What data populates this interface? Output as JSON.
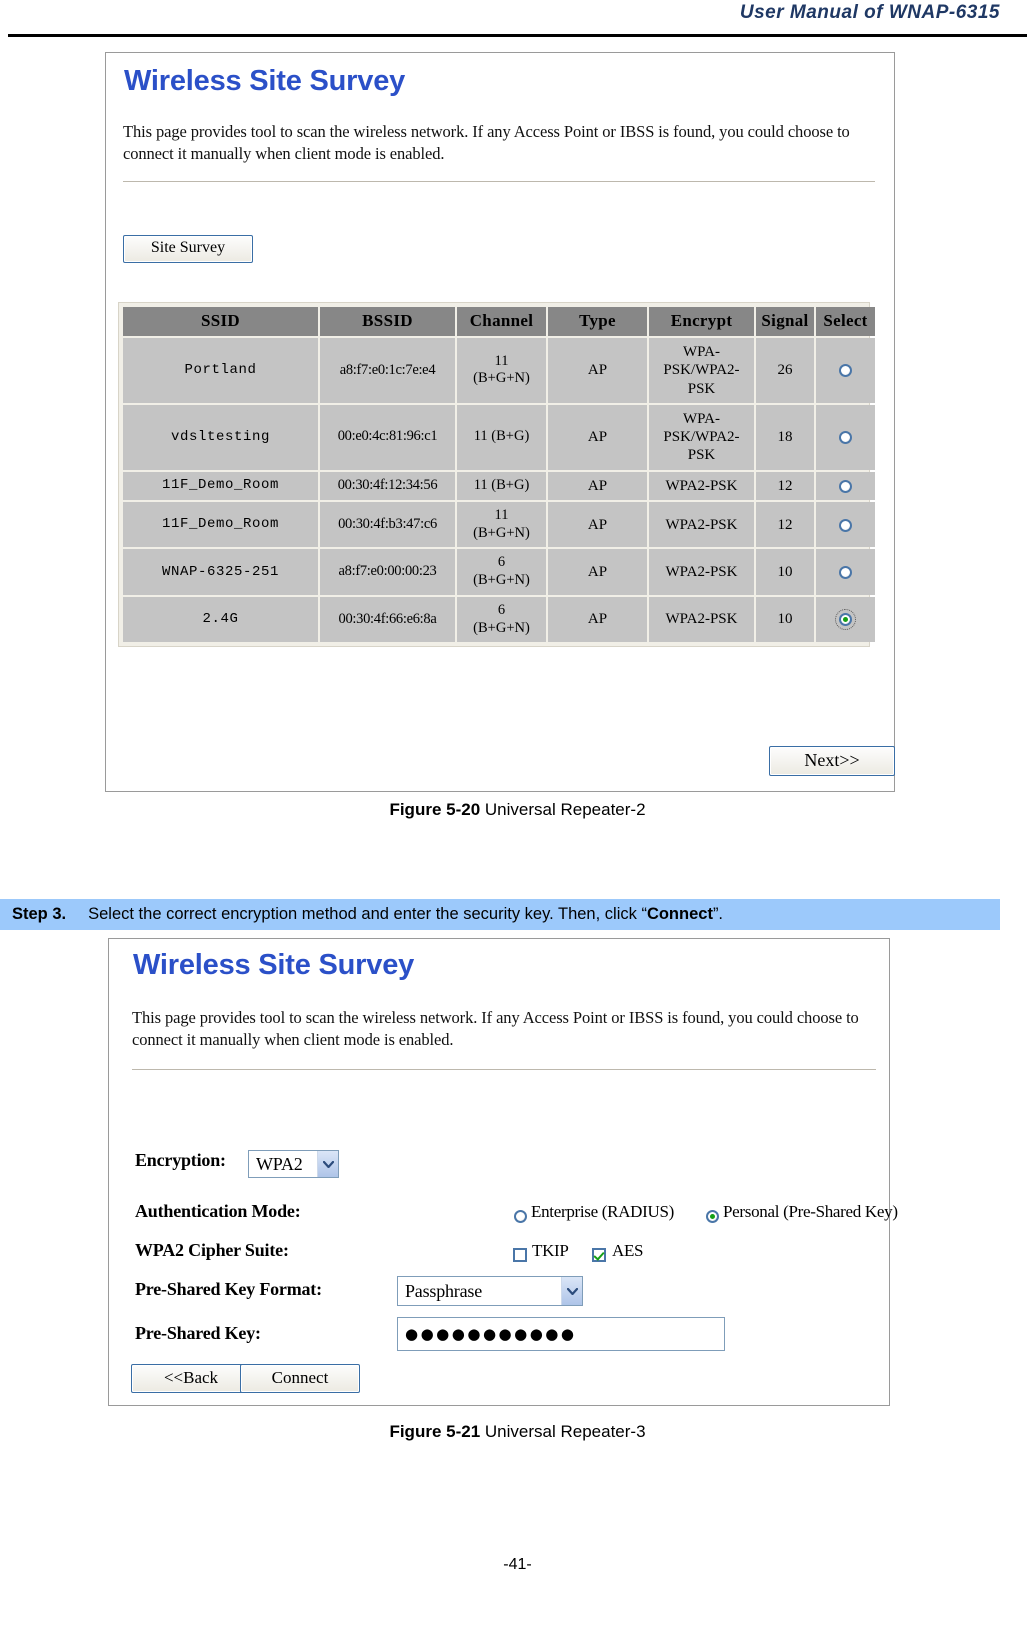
{
  "header": {
    "manual_title": "User  Manual  of  WNAP-6315"
  },
  "figure1": {
    "panel": {
      "title": "Wireless Site Survey",
      "description": "This page provides tool to scan the wireless network. If any Access Point or IBSS is found, you could choose to connect it manually when client mode is enabled.",
      "site_survey_button": "Site Survey",
      "next_button": "Next>>"
    },
    "table": {
      "columns": [
        "SSID",
        "BSSID",
        "Channel",
        "Type",
        "Encrypt",
        "Signal",
        "Select"
      ],
      "rows": [
        {
          "ssid": "Portland",
          "bssid": "a8:f7:e0:1c:7e:e4",
          "channel": "11 (B+G+N)",
          "type": "AP",
          "encrypt": "WPA-PSK/WPA2-PSK",
          "signal": "26",
          "selected": false
        },
        {
          "ssid": "vdsltesting",
          "bssid": "00:e0:4c:81:96:c1",
          "channel": "11 (B+G)",
          "type": "AP",
          "encrypt": "WPA-PSK/WPA2-PSK",
          "signal": "18",
          "selected": false
        },
        {
          "ssid": "11F_Demo_Room",
          "bssid": "00:30:4f:12:34:56",
          "channel": "11 (B+G)",
          "type": "AP",
          "encrypt": "WPA2-PSK",
          "signal": "12",
          "selected": false
        },
        {
          "ssid": "11F_Demo_Room",
          "bssid": "00:30:4f:b3:47:c6",
          "channel": "11 (B+G+N)",
          "type": "AP",
          "encrypt": "WPA2-PSK",
          "signal": "12",
          "selected": false
        },
        {
          "ssid": "WNAP-6325-251",
          "bssid": "a8:f7:e0:00:00:23",
          "channel": "6 (B+G+N)",
          "type": "AP",
          "encrypt": "WPA2-PSK",
          "signal": "10",
          "selected": false
        },
        {
          "ssid": "2.4G",
          "bssid": "00:30:4f:66:e6:8a",
          "channel": "6 (B+G+N)",
          "type": "AP",
          "encrypt": "WPA2-PSK",
          "signal": "10",
          "selected": true
        }
      ]
    },
    "caption_label": "Figure 5-20",
    "caption_text": "Universal Repeater-2"
  },
  "step3": {
    "label": "Step 3.",
    "text_before": "Select the correct encryption method and enter the security key. Then, click “",
    "bold_word": "Connect",
    "text_after": "”."
  },
  "figure2": {
    "panel": {
      "title": "Wireless Site Survey",
      "description": "This page provides tool to scan the wireless network. If any Access Point or IBSS is found, you could choose to connect it manually when client mode is enabled."
    },
    "form": {
      "encryption_label": "Encryption:",
      "encryption_value": "WPA2",
      "auth_mode_label": "Authentication Mode:",
      "auth_enterprise_label": "Enterprise (RADIUS)",
      "auth_enterprise_selected": false,
      "auth_personal_label": "Personal (Pre-Shared Key)",
      "auth_personal_selected": true,
      "cipher_label": "WPA2 Cipher Suite:",
      "cipher_tkip_label": "TKIP",
      "cipher_tkip_checked": false,
      "cipher_aes_label": "AES",
      "cipher_aes_checked": true,
      "psk_format_label": "Pre-Shared Key Format:",
      "psk_format_value": "Passphrase",
      "psk_label": "Pre-Shared Key:",
      "psk_value_masked": "●●●●●●●●●●●",
      "back_button": "<<Back",
      "connect_button": "Connect"
    },
    "caption_label": "Figure 5-21",
    "caption_text": "Universal Repeater-3"
  },
  "footer": {
    "page_number": "-41-"
  }
}
